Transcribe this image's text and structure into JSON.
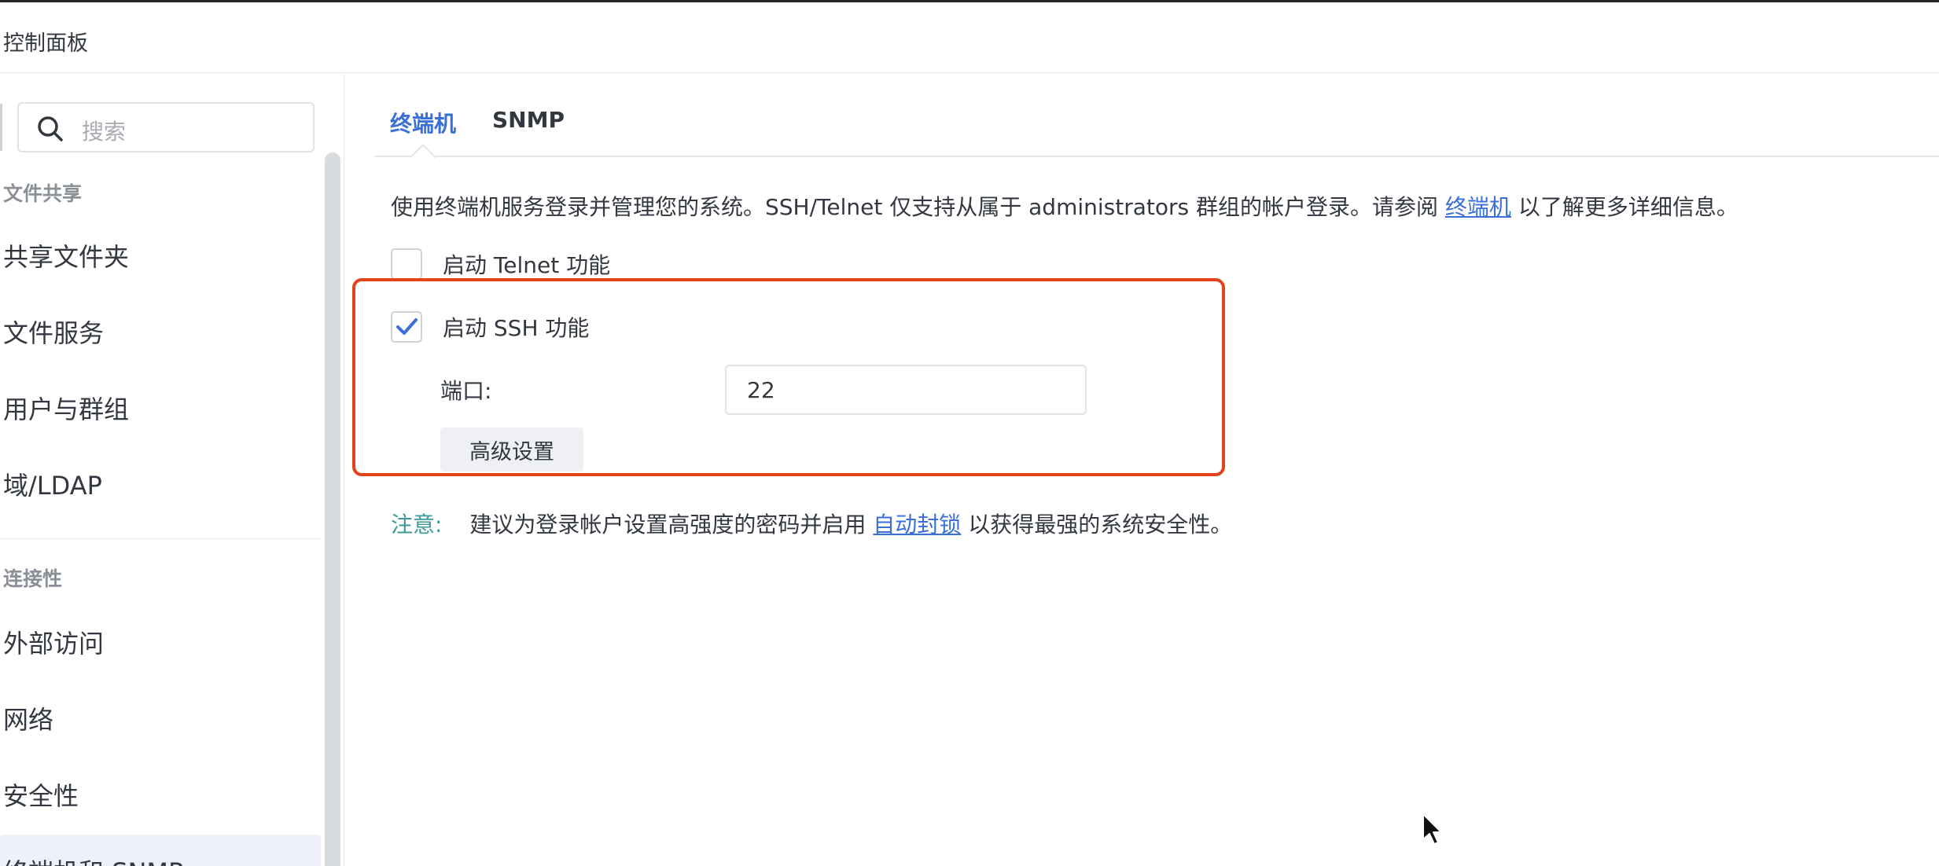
{
  "window": {
    "title": "控制面板"
  },
  "sidebar": {
    "search": {
      "placeholder": "搜索",
      "icon": "search-icon"
    },
    "sections": [
      {
        "title": "文件共享",
        "items": [
          "共享文件夹",
          "文件服务",
          "用户与群组",
          "域/LDAP"
        ]
      },
      {
        "title": "连接性",
        "items": [
          "外部访问",
          "网络",
          "安全性",
          "终端机和 SNMP"
        ]
      }
    ],
    "active_item": "终端机和 SNMP"
  },
  "tabs": [
    {
      "label": "终端机",
      "active": true
    },
    {
      "label": "SNMP",
      "active": false
    }
  ],
  "terminal": {
    "description_prefix": "使用终端机服务登录并管理您的系统。SSH/Telnet 仅支持从属于 administrators 群组的帐户登录。请参阅",
    "description_link": "终端机",
    "description_suffix": "以了解更多详细信息。",
    "telnet": {
      "label": "启动 Telnet 功能",
      "checked": false
    },
    "ssh": {
      "label": "启动 SSH 功能",
      "checked": true
    },
    "port": {
      "label": "端口:",
      "value": "22"
    },
    "advanced_button": "高级设置",
    "note": {
      "label": "注意:",
      "text_prefix": "建议为登录帐户设置高强度的密码并启用",
      "link": "自动封锁",
      "text_suffix": "以获得最强的系统安全性。"
    }
  },
  "colors": {
    "accent": "#3a6fd8",
    "highlight_box": "#e3421f",
    "note_label": "#3d9a9a"
  }
}
